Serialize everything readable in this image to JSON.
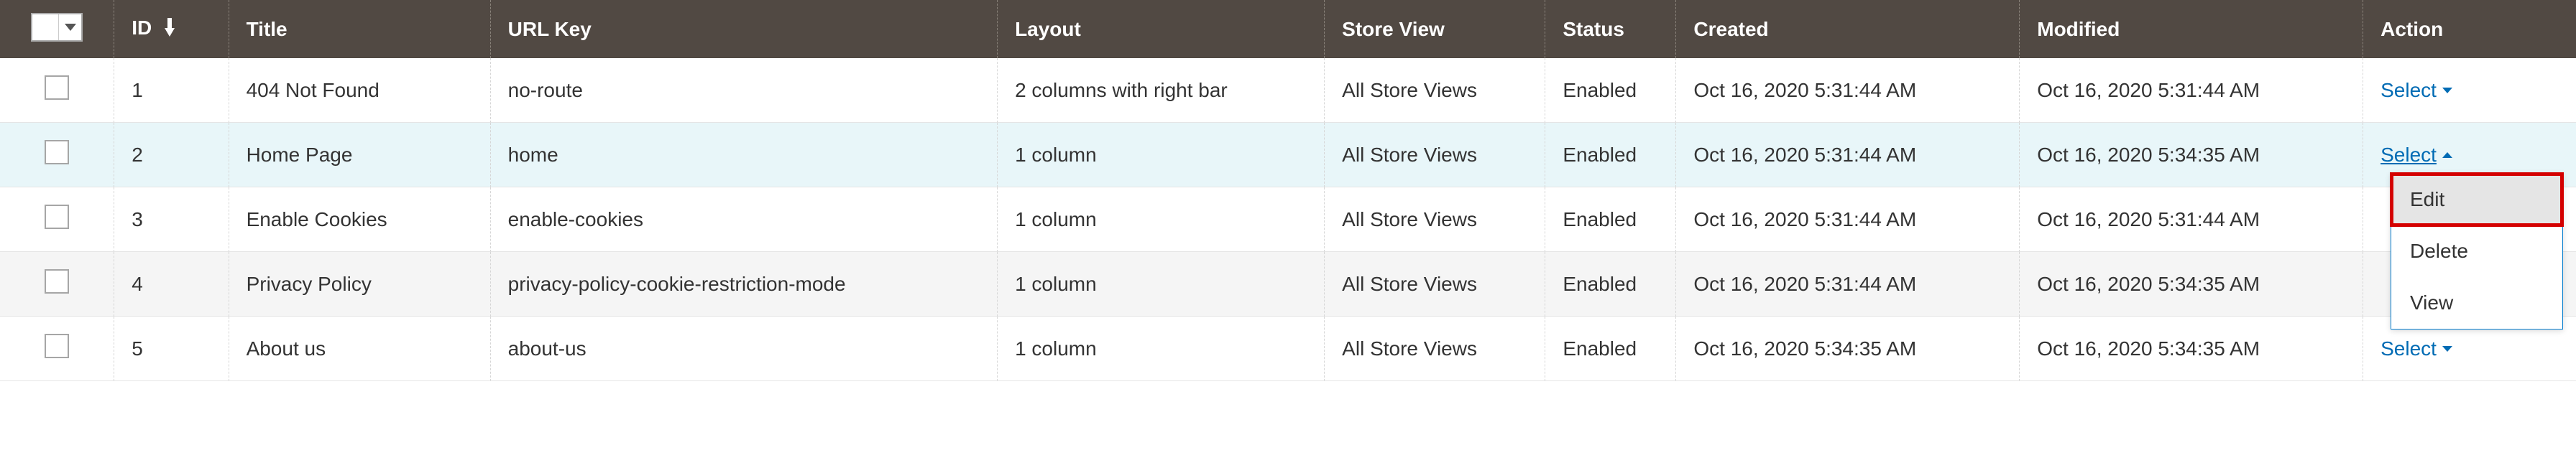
{
  "columns": {
    "id": "ID",
    "title": "Title",
    "url_key": "URL Key",
    "layout": "Layout",
    "store_view": "Store View",
    "status": "Status",
    "created": "Created",
    "modified": "Modified",
    "action": "Action"
  },
  "action_label": "Select",
  "dropdown": {
    "edit": "Edit",
    "delete": "Delete",
    "view": "View"
  },
  "rows": [
    {
      "id": "1",
      "title": "404 Not Found",
      "url_key": "no-route",
      "layout": "2 columns with right bar",
      "store_view": "All Store Views",
      "status": "Enabled",
      "created": "Oct 16, 2020 5:31:44 AM",
      "modified": "Oct 16, 2020 5:31:44 AM"
    },
    {
      "id": "2",
      "title": "Home Page",
      "url_key": "home",
      "layout": "1 column",
      "store_view": "All Store Views",
      "status": "Enabled",
      "created": "Oct 16, 2020 5:31:44 AM",
      "modified": "Oct 16, 2020 5:34:35 AM"
    },
    {
      "id": "3",
      "title": "Enable Cookies",
      "url_key": "enable-cookies",
      "layout": "1 column",
      "store_view": "All Store Views",
      "status": "Enabled",
      "created": "Oct 16, 2020 5:31:44 AM",
      "modified": "Oct 16, 2020 5:31:44 AM"
    },
    {
      "id": "4",
      "title": "Privacy Policy",
      "url_key": "privacy-policy-cookie-restriction-mode",
      "layout": "1 column",
      "store_view": "All Store Views",
      "status": "Enabled",
      "created": "Oct 16, 2020 5:31:44 AM",
      "modified": "Oct 16, 2020 5:34:35 AM"
    },
    {
      "id": "5",
      "title": "About us",
      "url_key": "about-us",
      "layout": "1 column",
      "store_view": "All Store Views",
      "status": "Enabled",
      "created": "Oct 16, 2020 5:34:35 AM",
      "modified": "Oct 16, 2020 5:34:35 AM"
    }
  ]
}
